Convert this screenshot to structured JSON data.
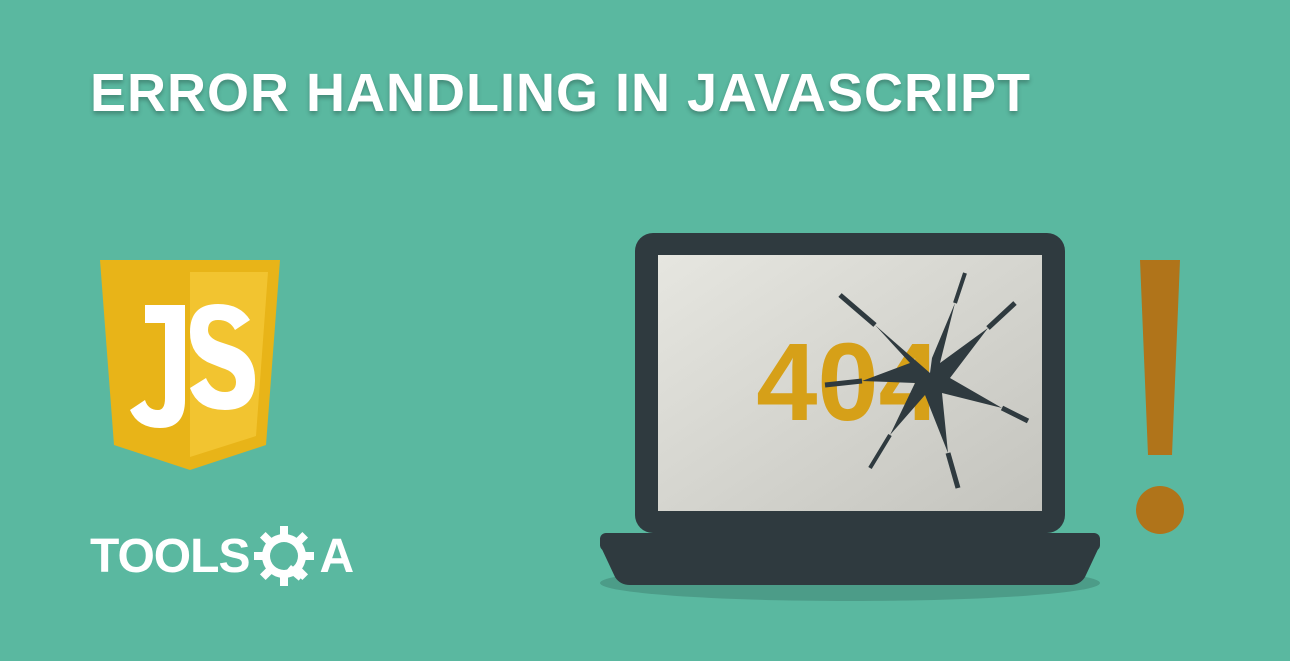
{
  "heading": "ERROR HANDLING IN JAVASCRIPT",
  "js_logo_text": "JS",
  "brand_prefix": "TOOLS",
  "brand_suffix": "A",
  "error_code": "404",
  "colors": {
    "background": "#5ab8a0",
    "js_yellow": "#e8b418",
    "js_yellow_light": "#f2c430",
    "laptop_dark": "#2f3a3f",
    "screen_grey": "#d4d4cf",
    "accent_brown": "#b0741a",
    "accent_yellow": "#d6a018",
    "white": "#ffffff"
  }
}
